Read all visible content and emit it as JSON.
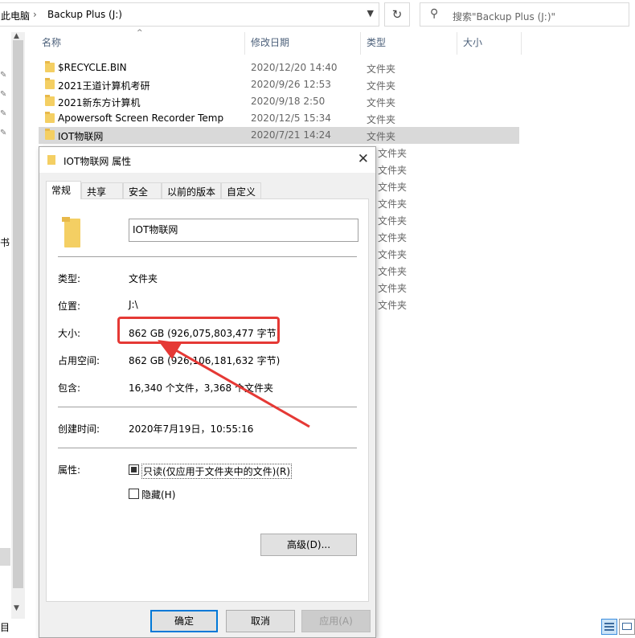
{
  "address": {
    "crumbs": [
      "此电脑",
      "Backup Plus (J:)"
    ]
  },
  "search": {
    "placeholder": "搜索\"Backup Plus (J:)\""
  },
  "nav": {
    "partial_label_1": "书",
    "partial_label_2": "目"
  },
  "columns": {
    "name": "名称",
    "date": "修改日期",
    "type": "类型",
    "size": "大小"
  },
  "files": [
    {
      "name": "$RECYCLE.BIN",
      "date": "2020/12/20 14:40",
      "type": "文件夹"
    },
    {
      "name": "2021王道计算机考研",
      "date": "2020/9/26 12:53",
      "type": "文件夹"
    },
    {
      "name": "2021新东方计算机",
      "date": "2020/9/18 2:50",
      "type": "文件夹"
    },
    {
      "name": "Apowersoft Screen Recorder Temp",
      "date": "2020/12/5 15:34",
      "type": "文件夹"
    },
    {
      "name": "IOT物联网",
      "date": "2020/7/21 14:24",
      "type": "文件夹",
      "selected": true
    }
  ],
  "hidden_rows_type": [
    "文件夹",
    "文件夹",
    "文件夹",
    "文件夹",
    "文件夹",
    "文件夹",
    "文件夹",
    "文件夹",
    "文件夹",
    "文件夹"
  ],
  "dialog": {
    "title": "IOT物联网 属性",
    "tabs": [
      "常规",
      "共享",
      "安全",
      "以前的版本",
      "自定义"
    ],
    "name_value": "IOT物联网",
    "type_label": "类型:",
    "type_value": "文件夹",
    "location_label": "位置:",
    "location_value": "J:\\",
    "size_label": "大小:",
    "size_value": "862 GB (926,075,803,477 字节)",
    "disk_label": "占用空间:",
    "disk_value": "862 GB (926,106,181,632 字节)",
    "contains_label": "包含:",
    "contains_value": "16,340 个文件，3,368 个文件夹",
    "created_label": "创建时间:",
    "created_value": "2020年7月19日，10:55:16",
    "attr_label": "属性:",
    "readonly_label": "只读(仅应用于文件夹中的文件)(R)",
    "hidden_label": "隐藏(H)",
    "advanced_label": "高级(D)...",
    "ok_label": "确定",
    "cancel_label": "取消",
    "apply_label": "应用(A)"
  }
}
